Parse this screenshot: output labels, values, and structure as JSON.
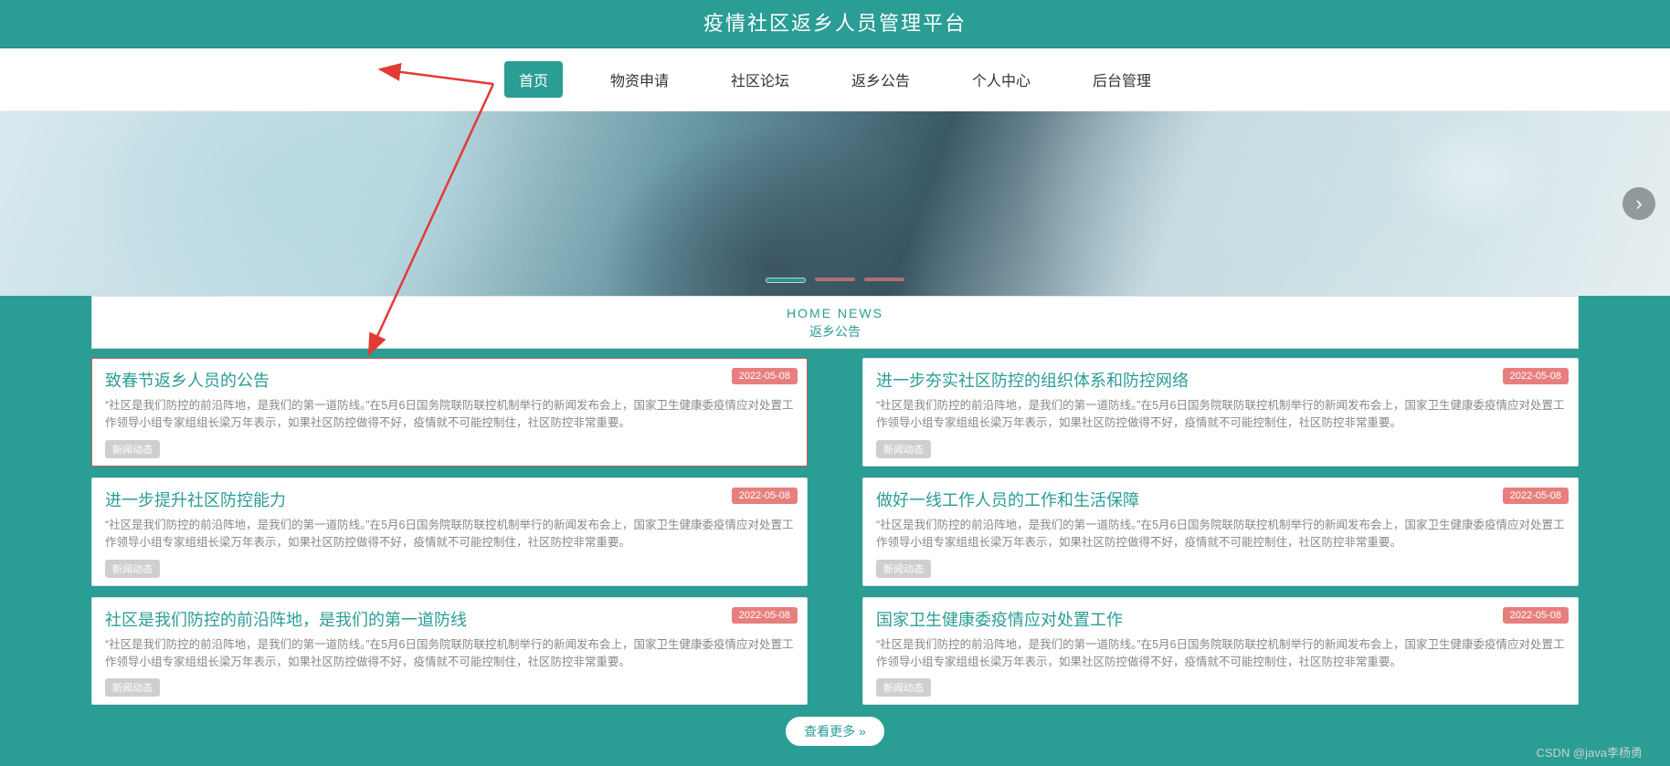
{
  "header": {
    "title": "疫情社区返乡人员管理平台"
  },
  "nav": {
    "items": [
      {
        "label": "首页",
        "active": true
      },
      {
        "label": "物资申请",
        "active": false
      },
      {
        "label": "社区论坛",
        "active": false
      },
      {
        "label": "返乡公告",
        "active": false
      },
      {
        "label": "个人中心",
        "active": false
      },
      {
        "label": "后台管理",
        "active": false
      }
    ]
  },
  "section": {
    "en": "HOME NEWS",
    "cn": "返乡公告"
  },
  "news": [
    {
      "title": "致春节返乡人员的公告",
      "date": "2022-05-08",
      "tag": "新闻动态",
      "desc": "“社区是我们防控的前沿阵地，是我们的第一道防线。”在5月6日国务院联防联控机制举行的新闻发布会上，国家卫生健康委疫情应对处置工作领导小组专家组组长梁万年表示，如果社区防控做得不好，疫情就不可能控制住，社区防控非常重要。"
    },
    {
      "title": "进一步夯实社区防控的组织体系和防控网络",
      "date": "2022-05-08",
      "tag": "新闻动态",
      "desc": "“社区是我们防控的前沿阵地，是我们的第一道防线。”在5月6日国务院联防联控机制举行的新闻发布会上，国家卫生健康委疫情应对处置工作领导小组专家组组长梁万年表示，如果社区防控做得不好，疫情就不可能控制住，社区防控非常重要。"
    },
    {
      "title": "进一步提升社区防控能力",
      "date": "2022-05-08",
      "tag": "新闻动态",
      "desc": "“社区是我们防控的前沿阵地，是我们的第一道防线。”在5月6日国务院联防联控机制举行的新闻发布会上，国家卫生健康委疫情应对处置工作领导小组专家组组长梁万年表示，如果社区防控做得不好，疫情就不可能控制住，社区防控非常重要。"
    },
    {
      "title": "做好一线工作人员的工作和生活保障",
      "date": "2022-05-08",
      "tag": "新闻动态",
      "desc": "“社区是我们防控的前沿阵地，是我们的第一道防线。”在5月6日国务院联防联控机制举行的新闻发布会上，国家卫生健康委疫情应对处置工作领导小组专家组组长梁万年表示，如果社区防控做得不好，疫情就不可能控制住，社区防控非常重要。"
    },
    {
      "title": "社区是我们防控的前沿阵地，是我们的第一道防线",
      "date": "2022-05-08",
      "tag": "新闻动态",
      "desc": "“社区是我们防控的前沿阵地，是我们的第一道防线。”在5月6日国务院联防联控机制举行的新闻发布会上，国家卫生健康委疫情应对处置工作领导小组专家组组长梁万年表示，如果社区防控做得不好，疫情就不可能控制住，社区防控非常重要。"
    },
    {
      "title": "国家卫生健康委疫情应对处置工作",
      "date": "2022-05-08",
      "tag": "新闻动态",
      "desc": "“社区是我们防控的前沿阵地，是我们的第一道防线。”在5月6日国务院联防联控机制举行的新闻发布会上，国家卫生健康委疫情应对处置工作领导小组专家组组长梁万年表示，如果社区防控做得不好，疫情就不可能控制住，社区防控非常重要。"
    }
  ],
  "more_label": "查看更多 »",
  "watermark": "CSDN @java李杨勇"
}
